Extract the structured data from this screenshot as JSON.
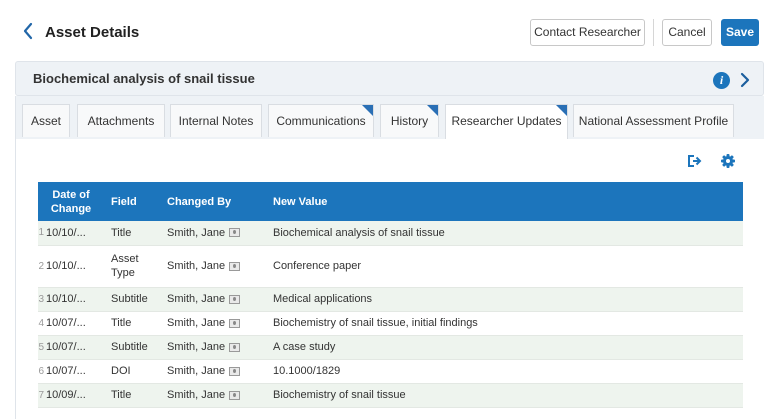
{
  "header": {
    "title": "Asset Details",
    "buttons": {
      "contact": "Contact Researcher",
      "cancel": "Cancel",
      "save": "Save"
    }
  },
  "record": {
    "title": "Biochemical analysis of snail tissue"
  },
  "tabs": [
    {
      "label": "Asset",
      "flag": false,
      "active": false
    },
    {
      "label": "Attachments",
      "flag": false,
      "active": false
    },
    {
      "label": "Internal Notes",
      "flag": false,
      "active": false
    },
    {
      "label": "Communications",
      "flag": true,
      "active": false
    },
    {
      "label": "History",
      "flag": true,
      "active": false
    },
    {
      "label": "Researcher Updates",
      "flag": true,
      "active": true
    },
    {
      "label": "National Assessment Profile",
      "flag": false,
      "active": false
    }
  ],
  "table": {
    "columns": {
      "date": "Date of Change",
      "field": "Field",
      "changed_by": "Changed By",
      "new_value": "New Value"
    },
    "rows": [
      {
        "idx": "1",
        "date": "10/10/...",
        "field": "Title",
        "changed_by": "Smith, Jane",
        "new_value": "Biochemical analysis of snail tissue"
      },
      {
        "idx": "2",
        "date": "10/10/...",
        "field": "Asset Type",
        "changed_by": "Smith, Jane",
        "new_value": "Conference paper"
      },
      {
        "idx": "3",
        "date": "10/10/...",
        "field": "Subtitle",
        "changed_by": "Smith, Jane",
        "new_value": "Medical applications"
      },
      {
        "idx": "4",
        "date": "10/07/...",
        "field": "Title",
        "changed_by": "Smith, Jane",
        "new_value": "Biochemistry of snail tissue, initial findings"
      },
      {
        "idx": "5",
        "date": "10/07/...",
        "field": "Subtitle",
        "changed_by": "Smith, Jane",
        "new_value": "A case study"
      },
      {
        "idx": "6",
        "date": "10/07/...",
        "field": "DOI",
        "changed_by": "Smith, Jane",
        "new_value": "10.1000/1829"
      },
      {
        "idx": "7",
        "date": "10/09/...",
        "field": "Title",
        "changed_by": "Smith, Jane",
        "new_value": "Biochemistry of snail tissue"
      }
    ]
  },
  "icons": {
    "back": "chevron-left-icon",
    "info": "info-icon",
    "expand": "chevron-right-icon",
    "export": "export-icon",
    "settings": "gear-icon",
    "user": "user-card-icon"
  },
  "colors": {
    "accent": "#1c75bc",
    "banner": "#eef2f6",
    "row_alt": "#eef4ee"
  }
}
